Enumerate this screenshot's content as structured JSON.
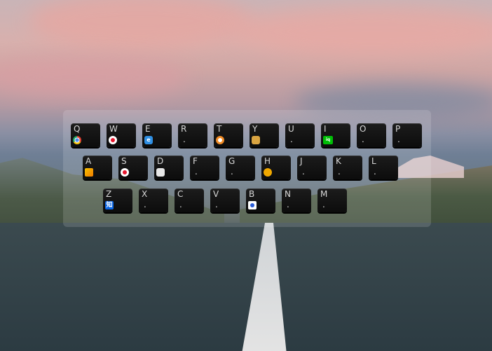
{
  "keyboard": {
    "rows": [
      [
        {
          "letter": "Q",
          "icon": "chrome-icon"
        },
        {
          "letter": "W",
          "icon": "weibo-icon"
        },
        {
          "letter": "E",
          "icon": "ie-browser-icon"
        },
        {
          "letter": "R",
          "icon": null
        },
        {
          "letter": "T",
          "icon": "clock-icon"
        },
        {
          "letter": "Y",
          "icon": "cat-icon"
        },
        {
          "letter": "U",
          "icon": null
        },
        {
          "letter": "I",
          "icon": "iqiyi-icon"
        },
        {
          "letter": "O",
          "icon": null
        },
        {
          "letter": "P",
          "icon": null
        }
      ],
      [
        {
          "letter": "A",
          "icon": "app-a-icon"
        },
        {
          "letter": "S",
          "icon": "weibo-icon"
        },
        {
          "letter": "D",
          "icon": "bird-icon"
        },
        {
          "letter": "F",
          "icon": null
        },
        {
          "letter": "G",
          "icon": null
        },
        {
          "letter": "H",
          "icon": "monster-icon"
        },
        {
          "letter": "J",
          "icon": null
        },
        {
          "letter": "K",
          "icon": null
        },
        {
          "letter": "L",
          "icon": null
        }
      ],
      [
        {
          "letter": "Z",
          "icon": "zhihu-icon"
        },
        {
          "letter": "X",
          "icon": null
        },
        {
          "letter": "C",
          "icon": null
        },
        {
          "letter": "V",
          "icon": null
        },
        {
          "letter": "B",
          "icon": "baidu-icon"
        },
        {
          "letter": "N",
          "icon": null
        },
        {
          "letter": "M",
          "icon": null
        }
      ]
    ],
    "empty_mark": ".",
    "zhihu_glyph": "知"
  },
  "colors": {
    "key_bg": "#111111",
    "key_text": "#d8d8d8",
    "panel": "rgba(255,255,255,0.14)"
  }
}
